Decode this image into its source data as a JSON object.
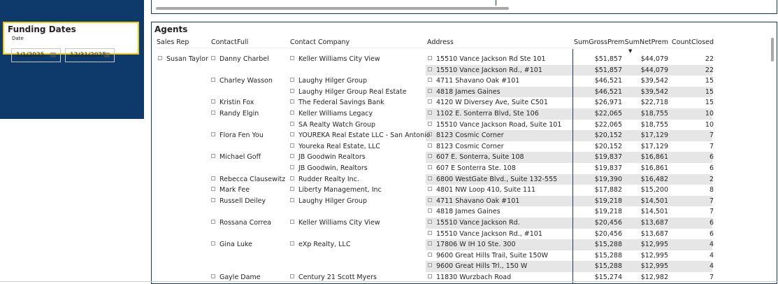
{
  "funding": {
    "title": "Funding Dates",
    "sub": "Date",
    "start": "1/1/2025",
    "end": "12/31/2025"
  },
  "agents": {
    "title": "Agents",
    "headers": {
      "sales_rep": "Sales Rep",
      "contact_full": "ContactFull",
      "contact_company": "Contact Company",
      "address": "Address",
      "gross": "SumGrossPrem",
      "net": "SumNetPrem",
      "closed": "CountClosed"
    },
    "rows": [
      {
        "rep": "Susan Taylor",
        "contact": "Danny Charbel",
        "company": "Keller Williams City View",
        "address": "15510 Vance Jackson Rd Ste 101",
        "gross": "$51,857",
        "net": "$44,079",
        "closed": "22",
        "shade": false
      },
      {
        "rep": "",
        "contact": "",
        "company": "",
        "address": "15510 Vance Jackson Rd., #101",
        "gross": "$51,857",
        "net": "$44,079",
        "closed": "22",
        "shade": true
      },
      {
        "rep": "",
        "contact": "Charley Wasson",
        "company": "Laughy Hilger Group",
        "address": "4711 Shavano Oak #101",
        "gross": "$46,521",
        "net": "$39,542",
        "closed": "15",
        "shade": false
      },
      {
        "rep": "",
        "contact": "",
        "company": "Laughy Hilger Group Real Estate",
        "address": "4818 James Gaines",
        "gross": "$46,521",
        "net": "$39,542",
        "closed": "15",
        "shade": true
      },
      {
        "rep": "",
        "contact": "Kristin Fox",
        "company": "The Federal Savings Bank",
        "address": "4120 W Diversey Ave, Suite C501",
        "gross": "$26,971",
        "net": "$22,718",
        "closed": "15",
        "shade": false
      },
      {
        "rep": "",
        "contact": "Randy Elgin",
        "company": "Keller Williams Legacy",
        "address": "1102 E. Sonterra Blvd, Ste 106",
        "gross": "$22,065",
        "net": "$18,755",
        "closed": "10",
        "shade": true
      },
      {
        "rep": "",
        "contact": "",
        "company": "SA Realty Watch Group",
        "address": "15510 Vance Jackson Road, Suite 101",
        "gross": "$22,065",
        "net": "$18,755",
        "closed": "10",
        "shade": false
      },
      {
        "rep": "",
        "contact": "Flora Fen You",
        "company": "YOUREKA Real Estate LLC - San Antonio",
        "address": "8123 Cosmic Corner",
        "gross": "$20,152",
        "net": "$17,129",
        "closed": "7",
        "shade": true
      },
      {
        "rep": "",
        "contact": "",
        "company": "Youreka Real Estate, LLC",
        "address": "8123 Cosmic Corner",
        "gross": "$20,152",
        "net": "$17,129",
        "closed": "7",
        "shade": false
      },
      {
        "rep": "",
        "contact": "Michael Goff",
        "company": "JB Goodwin Realtors",
        "address": "607 E. Sonterra, Suite 108",
        "gross": "$19,837",
        "net": "$16,861",
        "closed": "6",
        "shade": true
      },
      {
        "rep": "",
        "contact": "",
        "company": "JB Goodwin, Realtors",
        "address": "607 E Sonterra Ste. 108",
        "gross": "$19,837",
        "net": "$16,861",
        "closed": "6",
        "shade": false
      },
      {
        "rep": "",
        "contact": "Rebecca Clausewitz",
        "company": "Rudder Realty Inc.",
        "address": "6800 WestGate Blvd., Suite 132-555",
        "gross": "$19,390",
        "net": "$16,482",
        "closed": "2",
        "shade": true
      },
      {
        "rep": "",
        "contact": "Mark Fee",
        "company": "Liberty Management, Inc",
        "address": "4801 NW Loop 410, Suite 111",
        "gross": "$17,882",
        "net": "$15,200",
        "closed": "8",
        "shade": false
      },
      {
        "rep": "",
        "contact": "Russell Deiley",
        "company": "Laughy Hilger Group",
        "address": "4711 Shavano Oak #101",
        "gross": "$19,218",
        "net": "$14,501",
        "closed": "7",
        "shade": true
      },
      {
        "rep": "",
        "contact": "",
        "company": "",
        "address": "4818 James Gaines",
        "gross": "$19,218",
        "net": "$14,501",
        "closed": "7",
        "shade": false
      },
      {
        "rep": "",
        "contact": "Rossana Correa",
        "company": "Keller Williams City View",
        "address": "15510 Vance Jackson Rd.",
        "gross": "$20,456",
        "net": "$13,687",
        "closed": "6",
        "shade": true
      },
      {
        "rep": "",
        "contact": "",
        "company": "",
        "address": "15510 Vance Jackson Rd., #101",
        "gross": "$20,456",
        "net": "$13,687",
        "closed": "6",
        "shade": false
      },
      {
        "rep": "",
        "contact": "Gina Luke",
        "company": "eXp Realty, LLC",
        "address": "17806 W IH 10 Ste. 300",
        "gross": "$15,288",
        "net": "$12,995",
        "closed": "4",
        "shade": true
      },
      {
        "rep": "",
        "contact": "",
        "company": "",
        "address": "9600 Great Hills Trail, Suite 150W",
        "gross": "$15,288",
        "net": "$12,995",
        "closed": "4",
        "shade": false
      },
      {
        "rep": "",
        "contact": "",
        "company": "",
        "address": "9600 Great Hills Trl., 150 W",
        "gross": "$15,288",
        "net": "$12,995",
        "closed": "4",
        "shade": true
      },
      {
        "rep": "",
        "contact": "Gayle Dame",
        "company": "Century 21 Scott Myers",
        "address": "11830 Wurzbach Road",
        "gross": "$15,274",
        "net": "$12,982",
        "closed": "7",
        "shade": false
      }
    ]
  }
}
